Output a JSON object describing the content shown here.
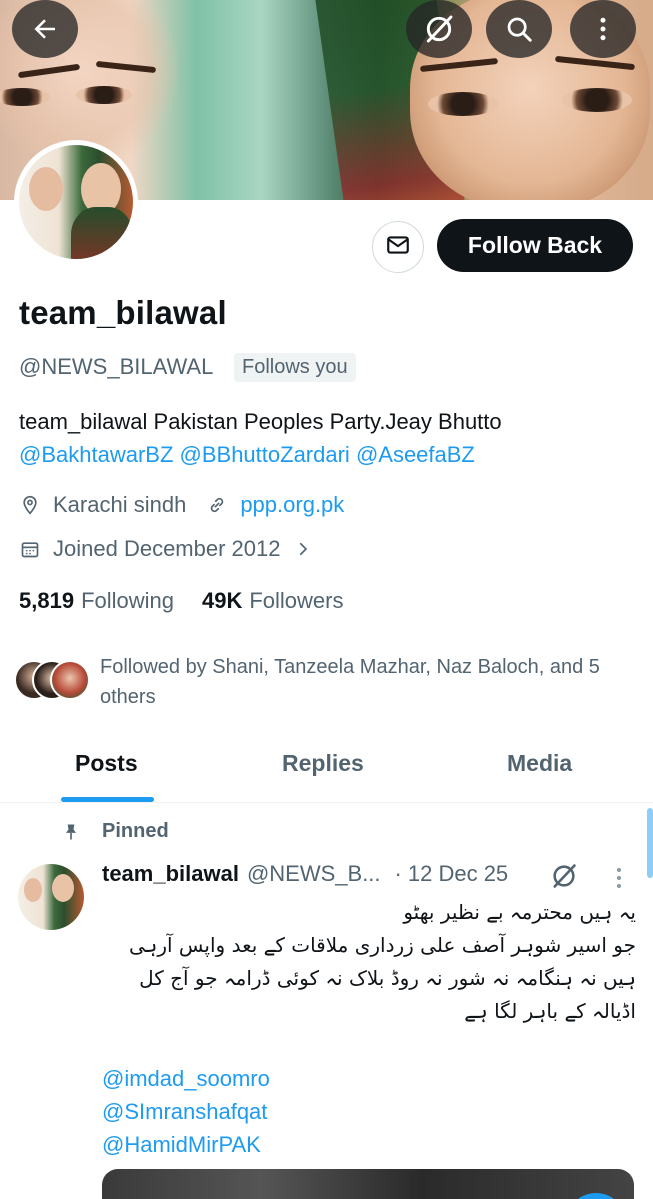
{
  "profile": {
    "display_name": "team_bilawal",
    "handle": "@NEWS_BILAWAL",
    "follows_you_badge": "Follows you",
    "bio_text": "team_bilawal Pakistan Peoples Party.Jeay Bhutto",
    "bio_mentions": [
      "@BakhtawarBZ",
      "@BBhuttoZardari",
      "@AseefaBZ"
    ],
    "location": "Karachi sindh",
    "website": "ppp.org.pk",
    "joined": "Joined December 2012",
    "following_count": "5,819",
    "following_label": "Following",
    "followers_count": "49K",
    "followers_label": "Followers",
    "followed_by": "Followed by Shani, Tanzeela Mazhar, Naz Baloch, and 5 others"
  },
  "actions": {
    "follow_back_label": "Follow Back"
  },
  "header": {
    "back_icon": "arrow-left-icon",
    "grok_icon": "grok-icon",
    "search_icon": "search-icon",
    "more_icon": "more-vertical-icon"
  },
  "tabs": [
    {
      "label": "Posts",
      "active": true
    },
    {
      "label": "Replies",
      "active": false
    },
    {
      "label": "Media",
      "active": false
    }
  ],
  "pinned_post": {
    "pinned_label": "Pinned",
    "author_name": "team_bilawal",
    "author_handle": "@NEWS_B...",
    "date": "12 Dec 25",
    "text_lines": [
      "یہ ہیں محترمہ بے نظیر بھٹو",
      "جو اسیر شوہر آصف علی زرداری ملاقات کے بعد واپس آرہی",
      "ہیں نہ ہنگامہ نہ شور نہ روڈ بلاک نہ کوئی ڈرامہ جو آج کل",
      "اڈیالہ کے باہر لگا ہے"
    ],
    "mentions": [
      "@imdad_soomro",
      "@SImranshafqat",
      "@HamidMirPAK"
    ]
  },
  "colors": {
    "accent": "#1d9bf0",
    "text_primary": "#0f1419",
    "text_secondary": "#536471",
    "button_dark": "#0f1419"
  }
}
